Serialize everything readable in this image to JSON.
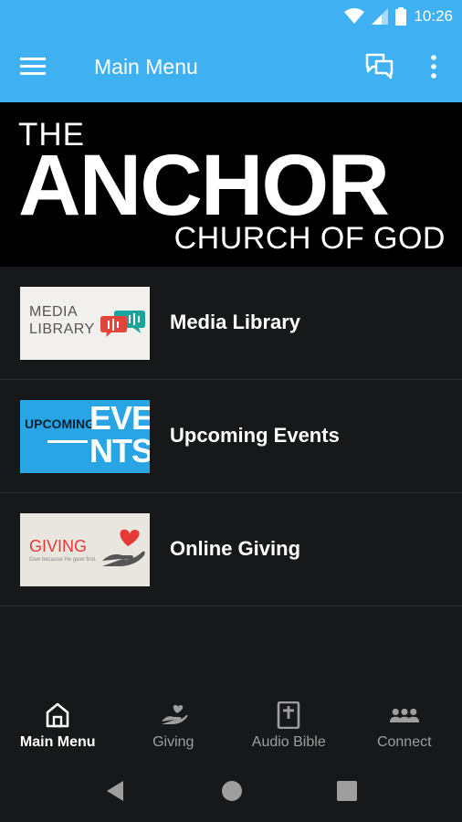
{
  "status_bar": {
    "time": "10:26",
    "icons": [
      "wifi-icon",
      "cell-signal-icon",
      "battery-icon"
    ]
  },
  "app_bar": {
    "title": "Main Menu",
    "icons": [
      "menu-icon",
      "chat-icon",
      "more-vertical-icon"
    ]
  },
  "banner": {
    "line1": "THE",
    "line2": "ANCHOR",
    "line3": "CHURCH OF GOD"
  },
  "menu_items": [
    {
      "label": "Media Library",
      "thumb_text": [
        "MEDIA",
        "LIBRARY"
      ]
    },
    {
      "label": "Upcoming Events",
      "thumb_text": [
        "UPCOMING",
        "EVE",
        "NTS"
      ]
    },
    {
      "label": "Online Giving",
      "thumb_text": [
        "GIVING",
        "Give because He gave first."
      ]
    }
  ],
  "bottom_nav": [
    {
      "label": "Main Menu",
      "icon": "home-icon",
      "active": true
    },
    {
      "label": "Giving",
      "icon": "giving-hand-icon",
      "active": false
    },
    {
      "label": "Audio Bible",
      "icon": "bible-icon",
      "active": false
    },
    {
      "label": "Connect",
      "icon": "people-icon",
      "active": false
    }
  ],
  "colors": {
    "app_bar": "#3fb0f1",
    "background": "#17181a",
    "banner": "#000000",
    "active_nav": "#ffffff",
    "inactive_nav": "#9e9e9e",
    "giving_red": "#e53935",
    "events_blue": "#29a4e4"
  }
}
